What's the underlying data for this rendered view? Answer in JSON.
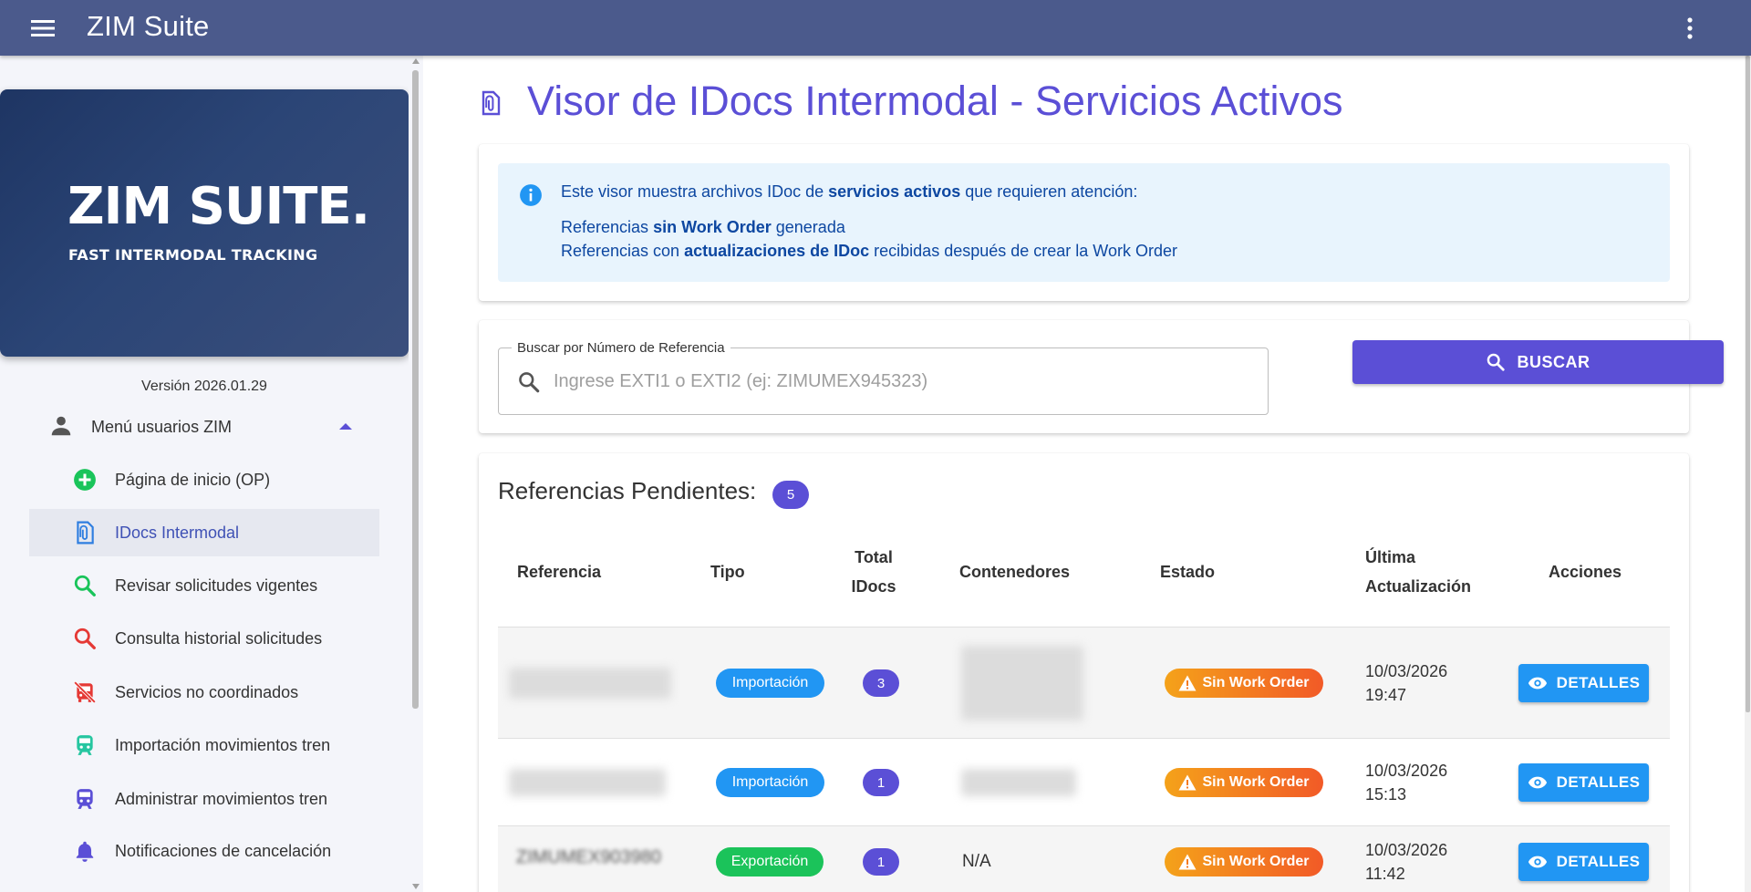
{
  "app": {
    "title": "ZIM Suite"
  },
  "sidebar": {
    "brand_main": "ZIM SUITE.",
    "brand_sub": "FAST INTERMODAL TRACKING",
    "version": "Versión 2026.01.29",
    "group_label": "Menú usuarios ZIM",
    "items": [
      {
        "label": "Página de inicio (OP)",
        "icon": "add-circle-icon",
        "color": "#19c45a"
      },
      {
        "label": "IDocs Intermodal",
        "icon": "document-clip-icon",
        "color": "#2f7ee0"
      },
      {
        "label": "Revisar solicitudes vigentes",
        "icon": "search-icon",
        "color": "#19c45a"
      },
      {
        "label": "Consulta historial solicitudes",
        "icon": "search-icon",
        "color": "#e53935"
      },
      {
        "label": "Servicios no coordinados",
        "icon": "bus-off-icon",
        "color": "#e53935"
      },
      {
        "label": "Importación movimientos tren",
        "icon": "train-icon",
        "color": "#26c6a0"
      },
      {
        "label": "Administrar movimientos tren",
        "icon": "train-icon",
        "color": "#5b4fd6"
      },
      {
        "label": "Notificaciones de cancelación",
        "icon": "bell-icon",
        "color": "#5b4fd6"
      }
    ]
  },
  "main": {
    "title": "Visor de IDocs Intermodal - Servicios Activos",
    "info": {
      "l1_a": "Este visor muestra archivos IDoc de ",
      "l1_b": "servicios activos",
      "l1_c": " que requieren atención:",
      "l2_a": "Referencias ",
      "l2_b": "sin Work Order",
      "l2_c": " generada",
      "l3_a": "Referencias con ",
      "l3_b": "actualizaciones de IDoc",
      "l3_c": " recibidas después de crear la Work Order"
    },
    "search": {
      "legend": "Buscar por Número de Referencia",
      "placeholder": "Ingrese EXTI1 o EXTI2 (ej: ZIMUMEX945323)",
      "button_label": "BUSCAR"
    },
    "table": {
      "title": "Referencias Pendientes:",
      "count": "5",
      "headers": {
        "referencia": "Referencia",
        "tipo": "Tipo",
        "total_1": "Total",
        "total_2": "IDocs",
        "contenedores": "Contenedores",
        "estado": "Estado",
        "ultima_1": "Última",
        "ultima_2": "Actualización",
        "acciones": "Acciones"
      },
      "rows": [
        {
          "tipo": "Importación",
          "total": "3",
          "contenedores": "",
          "estado": "Sin Work Order",
          "date": "10/03/2026",
          "time": "19:47",
          "action": "DETALLES"
        },
        {
          "tipo": "Importación",
          "total": "1",
          "contenedores": "",
          "estado": "Sin Work Order",
          "date": "10/03/2026",
          "time": "15:13",
          "action": "DETALLES"
        },
        {
          "referencia": "ZIMUMEX903980",
          "tipo": "Exportación",
          "total": "1",
          "contenedores": "N/A",
          "estado": "Sin Work Order",
          "date": "10/03/2026",
          "time": "11:42",
          "action": "DETALLES"
        }
      ]
    }
  }
}
